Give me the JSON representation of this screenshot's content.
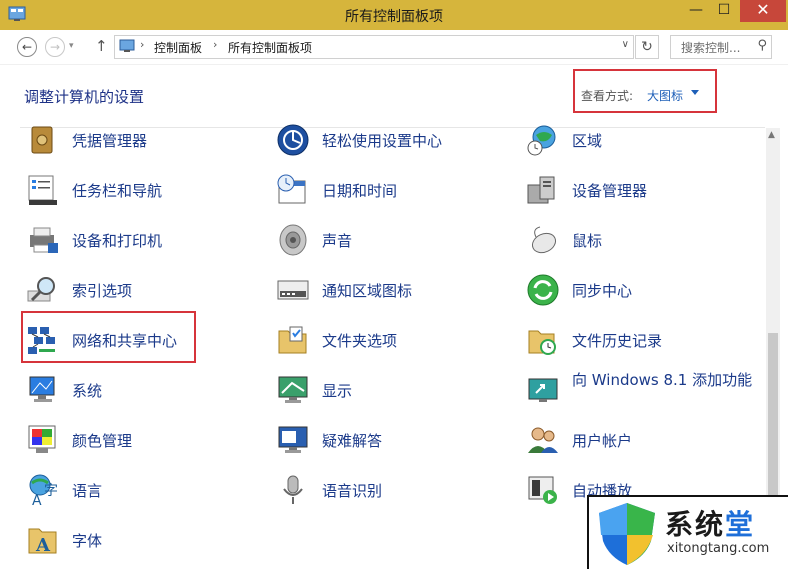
{
  "window": {
    "title": "所有控制面板项",
    "min": "—",
    "max": "☐",
    "close": "✕"
  },
  "nav": {
    "back": "←",
    "forward": "→",
    "recent": "▾",
    "up": "↑"
  },
  "address": {
    "segments": [
      "控制面板",
      "所有控制面板项"
    ],
    "sep": "›",
    "drop": "∨",
    "refresh": "↻"
  },
  "search": {
    "placeholder": "搜索控制...",
    "icon": "search-icon"
  },
  "heading": "调整计算机的设置",
  "view": {
    "label": "查看方式:",
    "value": "大图标"
  },
  "items": [
    [
      "凭据管理器",
      "轻松使用设置中心",
      "区域"
    ],
    [
      "任务栏和导航",
      "日期和时间",
      "设备管理器"
    ],
    [
      "设备和打印机",
      "声音",
      "鼠标"
    ],
    [
      "索引选项",
      "通知区域图标",
      "同步中心"
    ],
    [
      "网络和共享中心",
      "文件夹选项",
      "文件历史记录"
    ],
    [
      "系统",
      "显示",
      "向 Windows 8.1 添加功能"
    ],
    [
      "颜色管理",
      "疑难解答",
      "用户帐户"
    ],
    [
      "语言",
      "语音识别",
      "自动播放"
    ],
    [
      "字体"
    ]
  ],
  "watermark": {
    "cn": [
      "系统",
      "堂"
    ],
    "en": "xitongtang.com"
  },
  "colors": {
    "titlebar": "#d6b53c",
    "link": "#1b3a8a",
    "highlight": "#d6343b",
    "close": "#c7473a"
  }
}
